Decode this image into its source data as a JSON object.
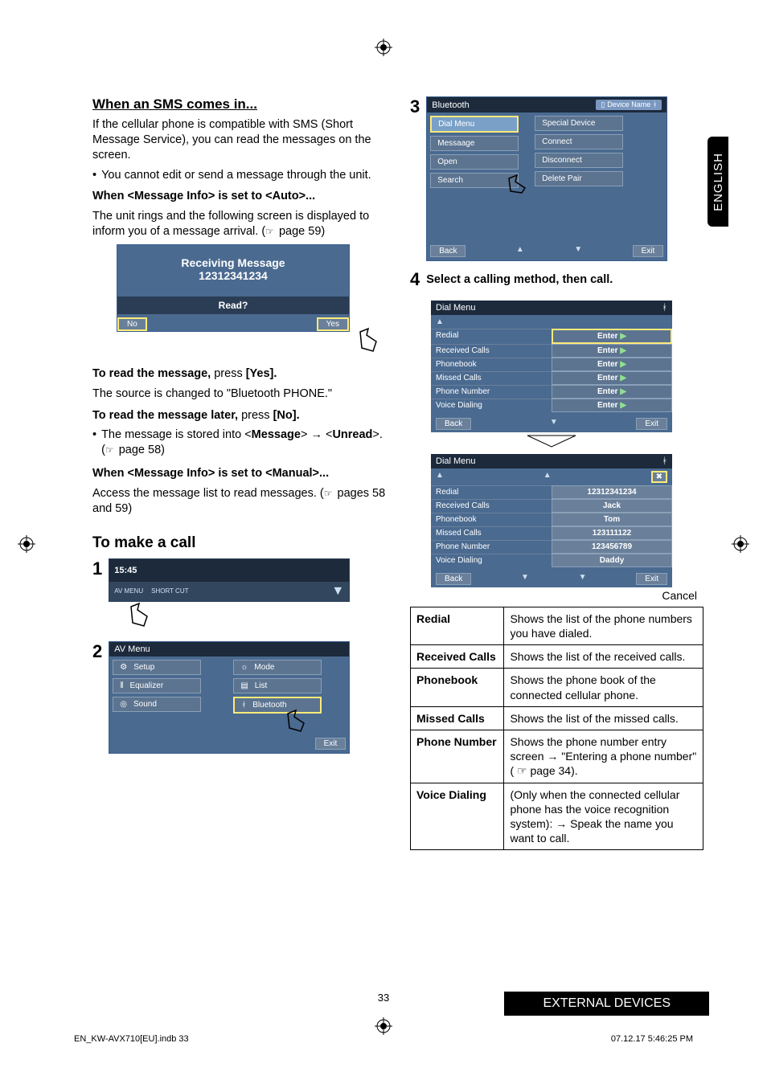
{
  "languageTab": "ENGLISH",
  "left": {
    "h_sms": "When an SMS comes in...",
    "p_sms1": "If the cellular phone is compatible with SMS (Short Message Service), you can read the messages on the screen.",
    "bul_sms1": "You cannot edit or send a message through the unit.",
    "h_auto": "When <Message Info> is set to <Auto>...",
    "p_auto1a": "The unit rings and the following screen is displayed to inform you of a message arrival. (",
    "p_auto1b": " page 59)",
    "fig_rx_l1": "Receiving Message",
    "fig_rx_l2": "12312341234",
    "fig_rx_read": "Read?",
    "fig_no": "No",
    "fig_yes": "Yes",
    "p_readA": "To read the message,",
    "p_readB": " press ",
    "p_readC": "[Yes].",
    "p_read2": "The source is changed to \"Bluetooth PHONE.\"",
    "p_laterA": "To read the message later,",
    "p_laterB": " press ",
    "p_laterC": "[No].",
    "bul_later_a": "The message is stored into  <",
    "bul_later_b": "Message",
    "bul_later_c": "> ",
    "bul_later_d": " <",
    "bul_later_e": "Unread",
    "bul_later_f": ">. (",
    "bul_later_g": " page 58)",
    "h_manual": "When <Message Info> is set to <Manual>...",
    "p_manual_a": "Access the message list to read messages. (",
    "p_manual_b": " pages 58 and 59)",
    "h_call": "To make a call",
    "fig1_time": "15:45",
    "fig1_av": "AV MENU",
    "fig1_short": "SHORT CUT",
    "fig2_title": "AV Menu",
    "fig2_setup": "Setup",
    "fig2_eq": "Equalizer",
    "fig2_sound": "Sound",
    "fig2_mode": "Mode",
    "fig2_list": "List",
    "fig2_bt": "Bluetooth",
    "fig2_exit": "Exit"
  },
  "right": {
    "fig3_hdr_l": "Bluetooth",
    "fig3_hdr_r": "Device Name",
    "fig3_l1": "Dial Menu",
    "fig3_l2": "Messaage",
    "fig3_l3": "Open",
    "fig3_l4": "Search",
    "fig3_r1": "Special Device",
    "fig3_r2": "Connect",
    "fig3_r3": "Disconnect",
    "fig3_r4": "Delete Pair",
    "fig3_back": "Back",
    "fig3_exit": "Exit",
    "step4": "Select a calling method, then call.",
    "fig4a_title": "Dial Menu",
    "rows_l": [
      "Redial",
      "Received Calls",
      "Phonebook",
      "Missed Calls",
      "Phone Number",
      "Voice Dialing"
    ],
    "fig4a_enter": "Enter",
    "fig4a_back": "Back",
    "fig4a_exit": "Exit",
    "fig4b_vals": [
      "12312341234",
      "Jack",
      "Tom",
      "123111122",
      "123456789",
      "Daddy"
    ],
    "fig4b_back": "Back",
    "fig4b_exit": "Exit",
    "cancel": "Cancel",
    "table": [
      {
        "k": "Redial",
        "v": "Shows the list of the phone numbers you have dialed."
      },
      {
        "k": "Received Calls",
        "v": "Shows the list of the received calls."
      },
      {
        "k": "Phonebook",
        "v": "Shows the phone book of the connected cellular phone."
      },
      {
        "k": "Missed Calls",
        "v": "Shows the list of the missed calls."
      },
      {
        "k": "Phone Number",
        "v": " Shows the phone number entry screen → \"Entering a phone number\" ( ☞ page 34)."
      },
      {
        "k": "Voice Dialing",
        "v": "(Only when the connected cellular phone has the voice recognition system): → Speak the name you want to call."
      }
    ]
  },
  "footer": {
    "pageNum": "33",
    "sectionBar": "EXTERNAL DEVICES",
    "metaLeft": "EN_KW-AVX710[EU].indb   33",
    "metaRight": "07.12.17   5:46:25 PM"
  }
}
